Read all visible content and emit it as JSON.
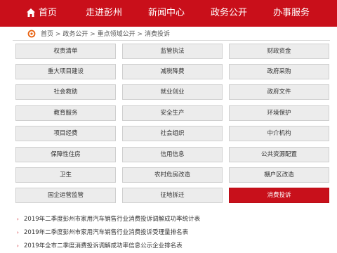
{
  "nav": {
    "items": [
      {
        "id": "home",
        "label": "首页"
      },
      {
        "id": "tour",
        "label": "走进彭州"
      },
      {
        "id": "news",
        "label": "新闻中心"
      },
      {
        "id": "affairs",
        "label": "政务公开"
      },
      {
        "id": "services",
        "label": "办事服务"
      }
    ],
    "bg_color": "#c90f1a"
  },
  "breadcrumb": {
    "items": [
      "首页",
      "政务公开",
      "重点领域公开",
      "消费投诉"
    ],
    "separator": ">"
  },
  "categories": {
    "rows": [
      [
        "权责清单",
        "监管执法",
        "财政资金"
      ],
      [
        "重大项目建设",
        "减税降费",
        "政府采购"
      ],
      [
        "社会救助",
        "就业创业",
        "政府文件"
      ],
      [
        "教育服务",
        "安全生产",
        "环境保护"
      ],
      [
        "项目经费",
        "社会组织",
        "中介机构"
      ],
      [
        "保障性住房",
        "信用信息",
        "公共资源配置"
      ],
      [
        "卫生",
        "农村危房改造",
        "棚户区改造"
      ],
      [
        "国企运营监管",
        "征地拆迁",
        "消费投诉"
      ]
    ],
    "active": "消费投诉",
    "active_color": "#c8101b"
  },
  "articles": [
    {
      "title": "2019年二季度彭州市家用汽车销售行业消费投诉调解成功率统计表"
    },
    {
      "title": "2019年二季度彭州市家用汽车销售行业消费投诉受理量排名表"
    },
    {
      "title": "2019年全市二季度消费投诉调解成功率信息公示企业排名表"
    }
  ]
}
